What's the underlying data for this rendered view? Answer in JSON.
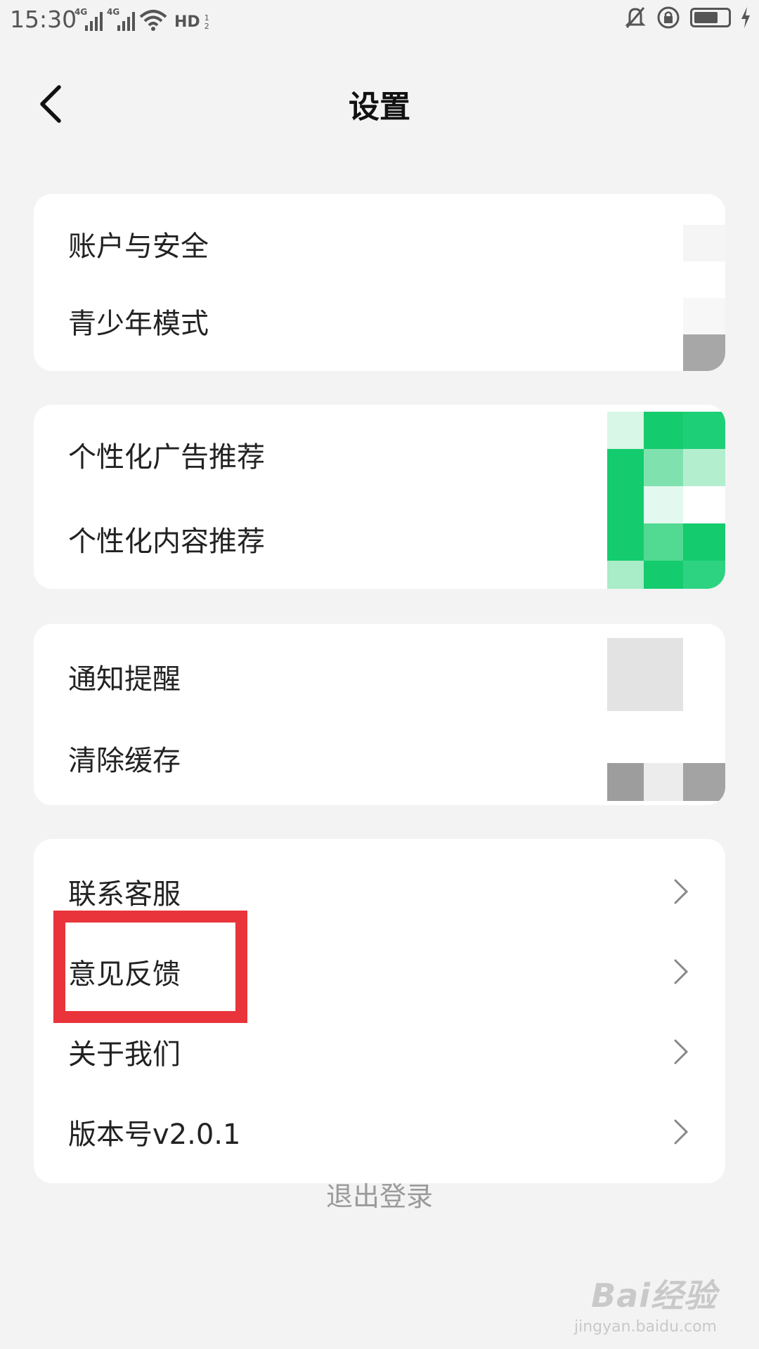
{
  "status_bar": {
    "time": "15:30",
    "network_1": "4G",
    "network_2": "4G",
    "hd_label": "HD",
    "hd_sub": "1 2",
    "battery_level": 0.75,
    "icons": [
      "signal-icon",
      "wifi-icon",
      "hd-call-icon",
      "mute-bell-icon",
      "orientation-lock-icon",
      "battery-icon",
      "charging-icon"
    ]
  },
  "nav": {
    "title": "设置",
    "back_icon": "back-chevron-icon"
  },
  "groups": [
    {
      "items": [
        {
          "label": "账户与安全"
        },
        {
          "label": "青少年模式"
        }
      ]
    },
    {
      "items": [
        {
          "label": "个性化广告推荐"
        },
        {
          "label": "个性化内容推荐"
        }
      ]
    },
    {
      "items": [
        {
          "label": "通知提醒"
        },
        {
          "label": "清除缓存"
        }
      ]
    },
    {
      "items": [
        {
          "label": "联系客服"
        },
        {
          "label": "意见反馈"
        },
        {
          "label": "关于我们"
        },
        {
          "label": "版本号v2.0.1"
        }
      ]
    }
  ],
  "logout_label": "退出登录",
  "watermark": {
    "brand": "Bai经验",
    "url": "jingyan.baidu.com"
  },
  "colors": {
    "accent_green": "#14cc6e",
    "annotation_red": "#e8343a",
    "page_bg": "#f3f3f3"
  }
}
